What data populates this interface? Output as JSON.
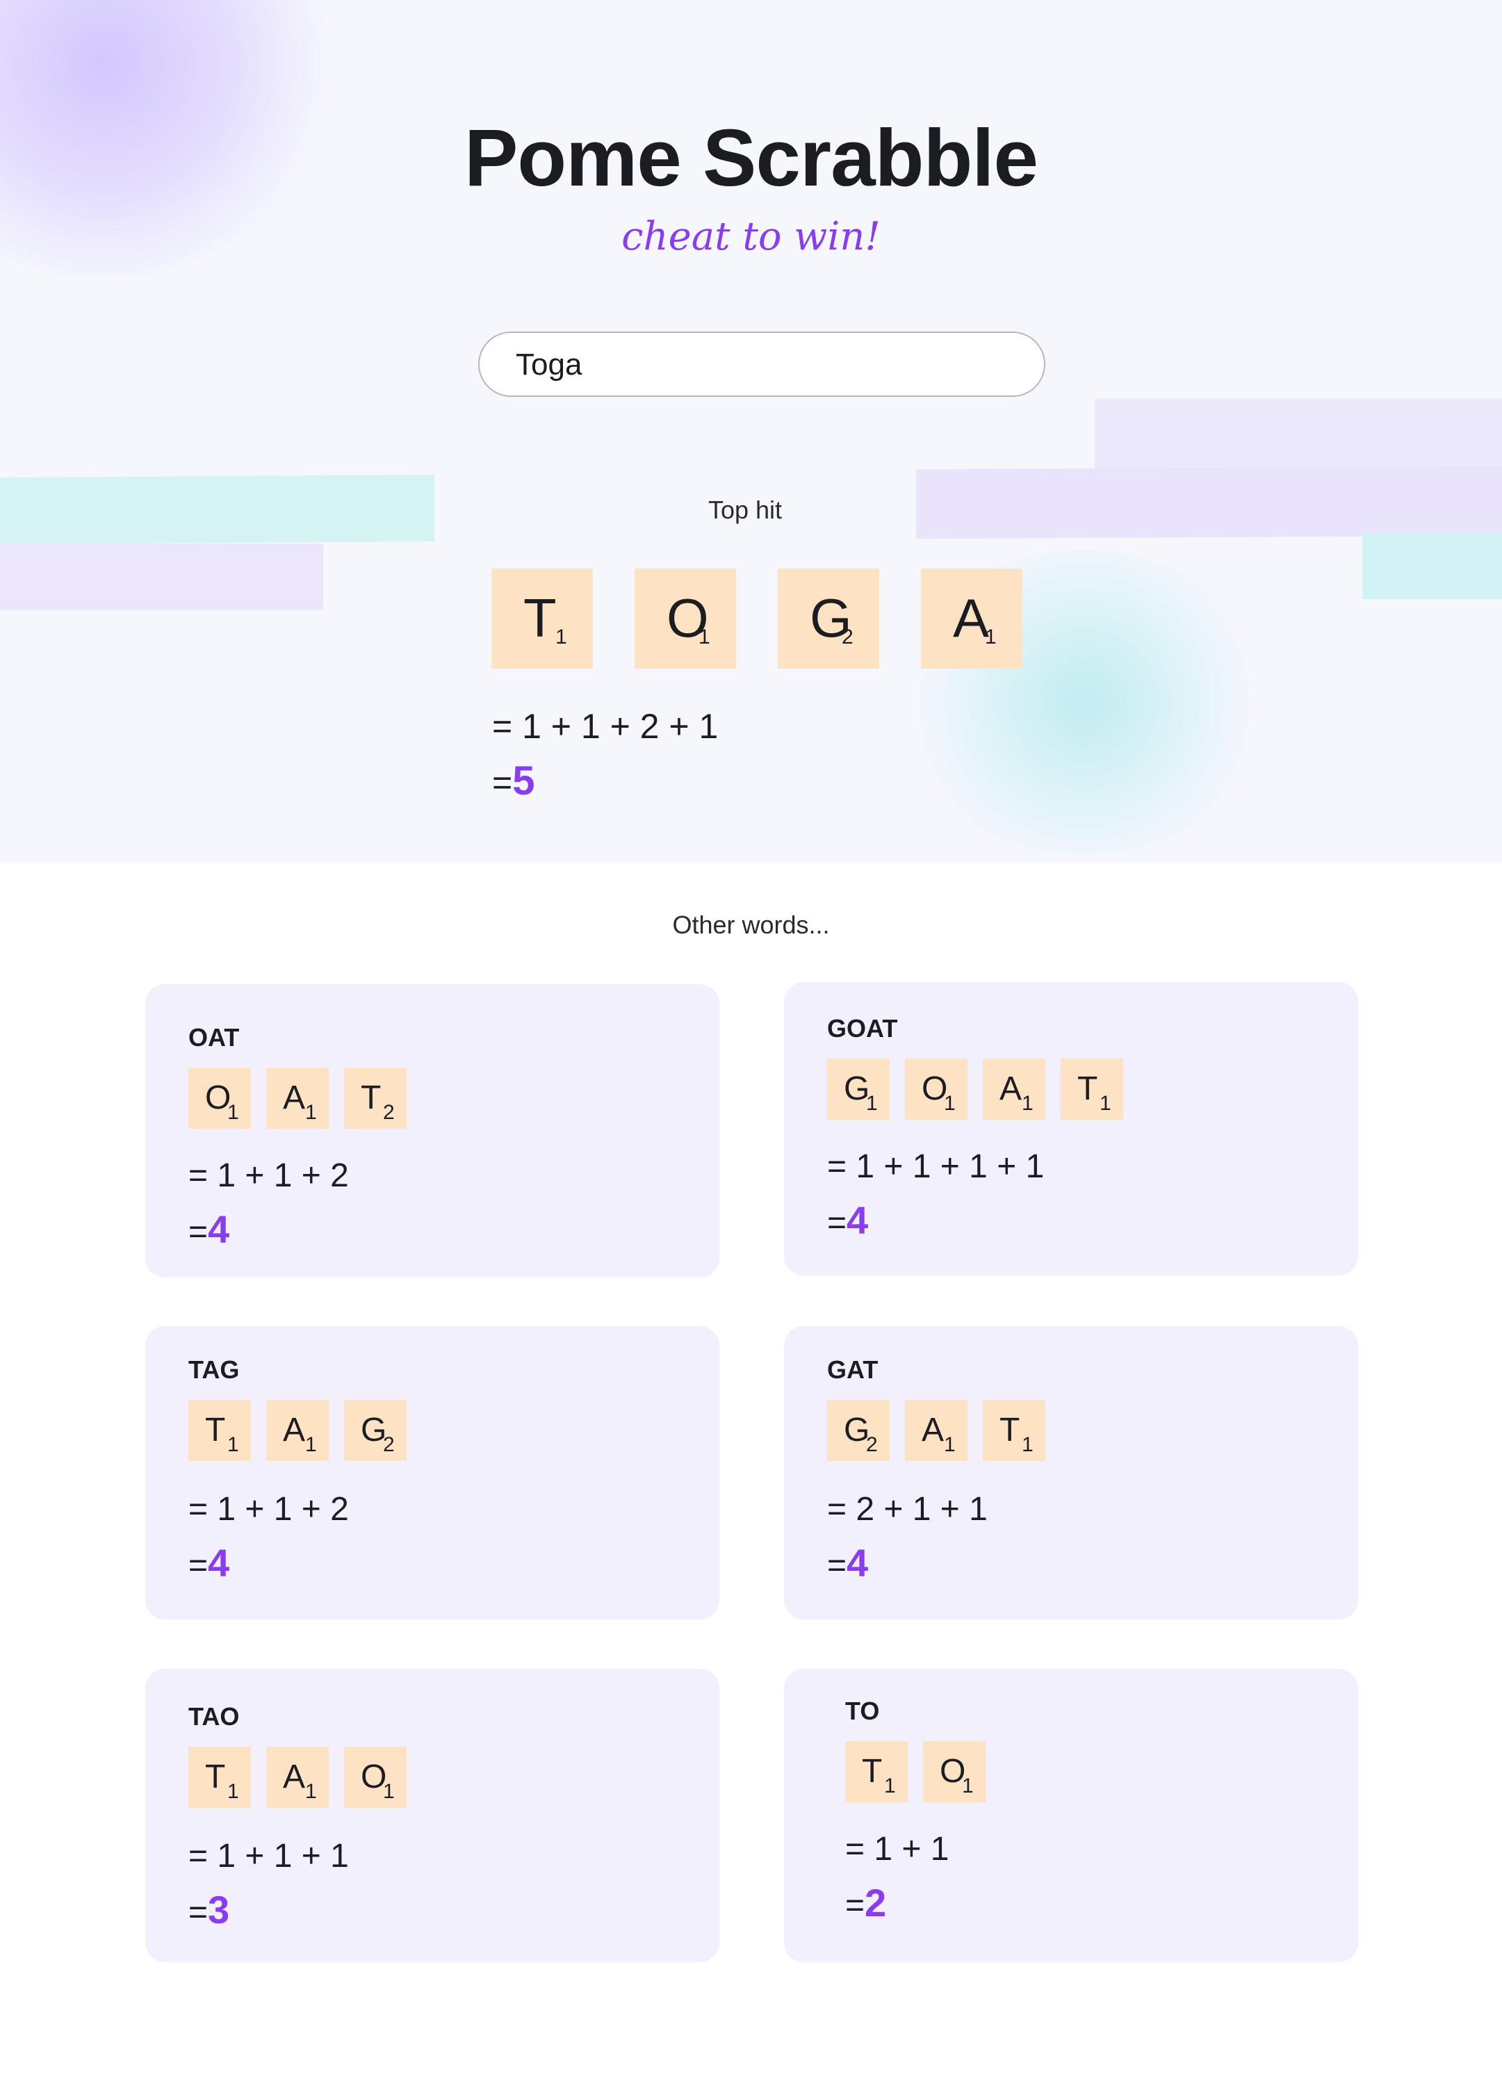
{
  "header": {
    "title": "Pome Scrabble",
    "subtitle": "cheat to win!"
  },
  "search": {
    "value": "Toga",
    "placeholder": ""
  },
  "top_hit": {
    "label": "Top hit",
    "tiles": [
      {
        "letter": "T",
        "points": "1"
      },
      {
        "letter": "O",
        "points": "1"
      },
      {
        "letter": "G",
        "points": "2"
      },
      {
        "letter": "A",
        "points": "1"
      }
    ],
    "equation": "= 1 + 1 + 2 + 1",
    "total_prefix": "=",
    "total": "5"
  },
  "other_words": {
    "label": "Other words...",
    "cards": [
      {
        "word": "OAT",
        "tiles": [
          {
            "letter": "O",
            "points": "1"
          },
          {
            "letter": "A",
            "points": "1"
          },
          {
            "letter": "T",
            "points": "2"
          }
        ],
        "equation": "= 1 + 1 + 2",
        "total_prefix": "=",
        "total": "4"
      },
      {
        "word": "GOAT",
        "tiles": [
          {
            "letter": "G",
            "points": "1"
          },
          {
            "letter": "O",
            "points": "1"
          },
          {
            "letter": "A",
            "points": "1"
          },
          {
            "letter": "T",
            "points": "1"
          }
        ],
        "equation": "= 1 + 1 + 1 + 1",
        "total_prefix": "=",
        "total": "4"
      },
      {
        "word": "TAG",
        "tiles": [
          {
            "letter": "T",
            "points": "1"
          },
          {
            "letter": "A",
            "points": "1"
          },
          {
            "letter": "G",
            "points": "2"
          }
        ],
        "equation": "= 1 + 1 + 2",
        "total_prefix": "=",
        "total": "4"
      },
      {
        "word": "GAT",
        "tiles": [
          {
            "letter": "G",
            "points": "2"
          },
          {
            "letter": "A",
            "points": "1"
          },
          {
            "letter": "T",
            "points": "1"
          }
        ],
        "equation": "= 2 + 1 + 1",
        "total_prefix": "=",
        "total": "4"
      },
      {
        "word": "TAO",
        "tiles": [
          {
            "letter": "T",
            "points": "1"
          },
          {
            "letter": "A",
            "points": "1"
          },
          {
            "letter": "O",
            "points": "1"
          }
        ],
        "equation": "= 1 + 1 + 1",
        "total_prefix": "=",
        "total": "3"
      },
      {
        "word": "TO",
        "tiles": [
          {
            "letter": "T",
            "points": "1"
          },
          {
            "letter": "O",
            "points": "1"
          }
        ],
        "equation": "= 1 + 1",
        "total_prefix": "=",
        "total": "2"
      }
    ]
  },
  "colors": {
    "accent": "#8a3cf0",
    "tile": "#fde2c3",
    "card": "#f2f0fd",
    "hero_bg": "#f5f7fd"
  }
}
